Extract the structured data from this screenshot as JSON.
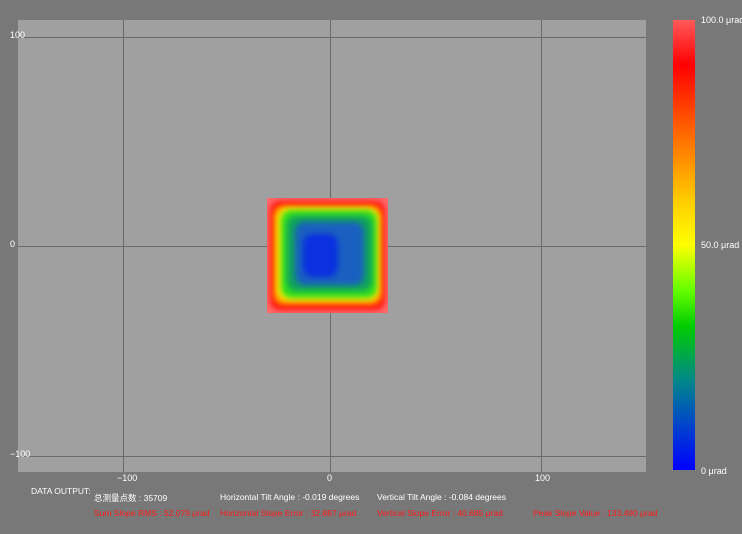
{
  "axes": {
    "y_ticks": [
      "100",
      "0",
      "−100"
    ],
    "x_ticks": [
      "−100",
      "0",
      "100"
    ]
  },
  "colorbar": {
    "max_label": "100.0 μrad",
    "mid_label": "50.0 μrad",
    "min_label": "0 μrad"
  },
  "data_output": {
    "label": "DATA OUTPUT:",
    "total_points": "总测量点数 : 35709",
    "h_tilt": "Horizontal Tilt Angle : -0.019 degrees",
    "v_tilt": "Vertical Tilt Angle : -0.084 degrees",
    "sum_rms": "Sum Slope RMS : 52.079 μrad",
    "h_error": "Horizontal Slope Error : 32.887 μrad",
    "v_error": "Vertical Slope Error : 40.685 μrad",
    "peak": "Peak Slope Value : 133.490 μrad"
  }
}
